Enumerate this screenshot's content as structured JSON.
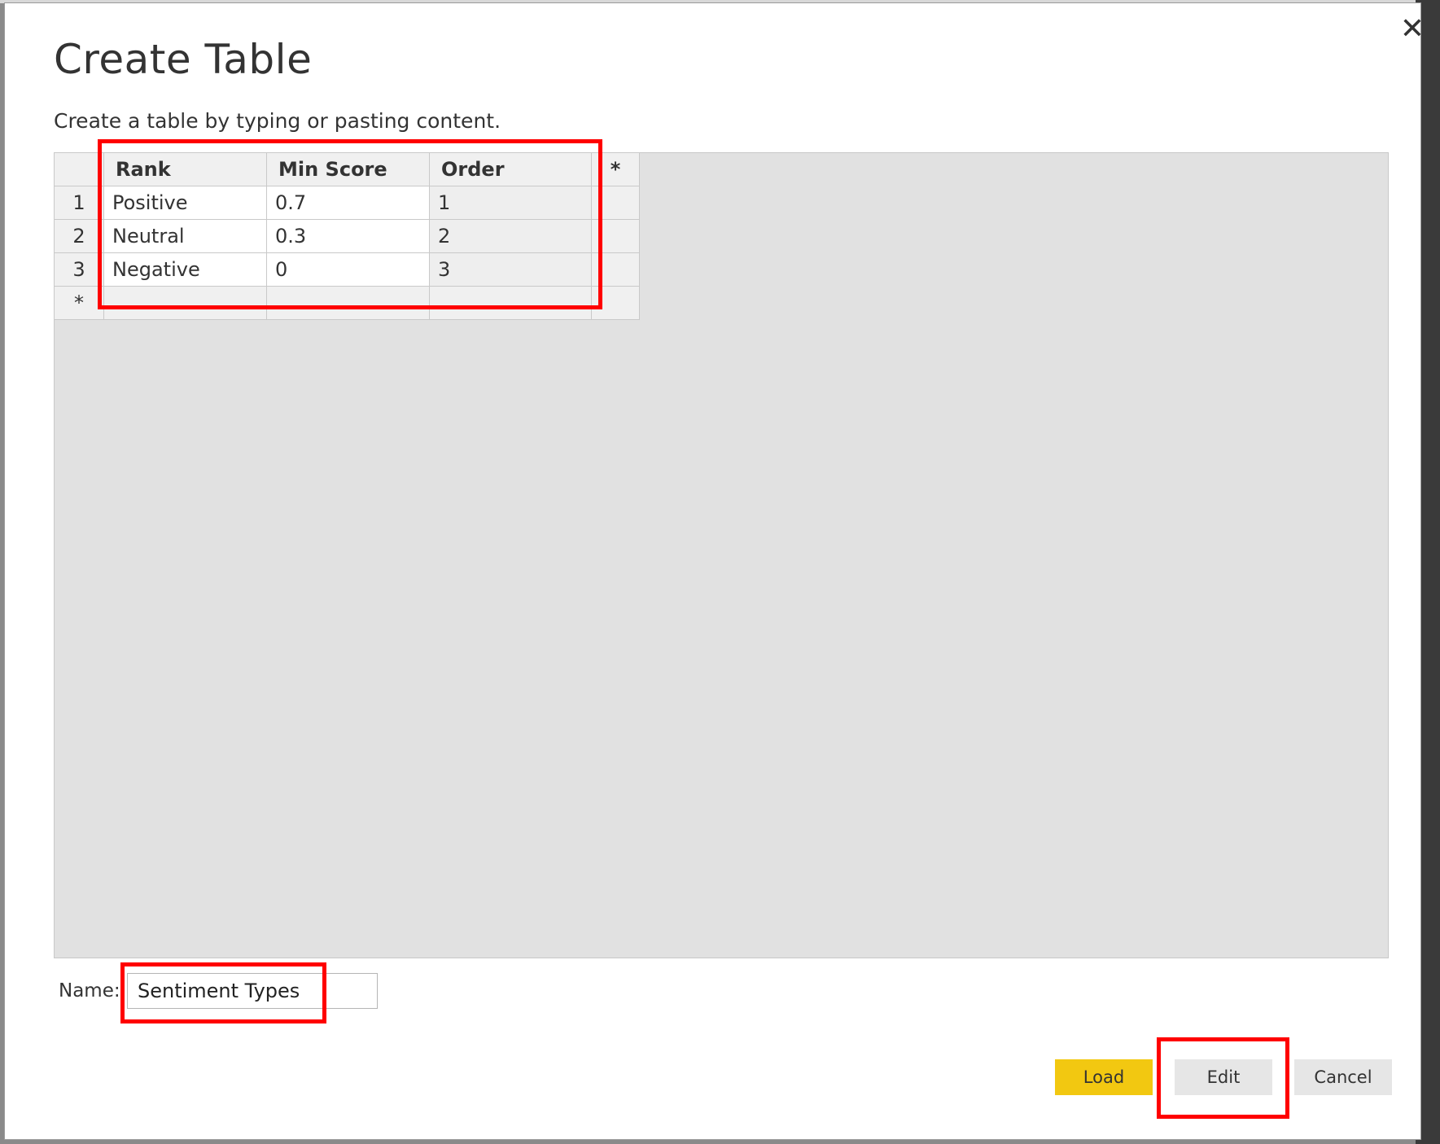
{
  "dialog": {
    "title": "Create Table",
    "subtitle": "Create a table by typing or pasting content.",
    "close_glyph": "✕"
  },
  "table": {
    "headers": [
      "Rank",
      "Min Score",
      "Order"
    ],
    "add_column_glyph": "*",
    "rows": [
      {
        "num": "1",
        "cells": [
          "Positive",
          "0.7",
          "1"
        ]
      },
      {
        "num": "2",
        "cells": [
          "Neutral",
          "0.3",
          "2"
        ]
      },
      {
        "num": "3",
        "cells": [
          "Negative",
          "0",
          "3"
        ]
      }
    ],
    "new_row_glyph": "*"
  },
  "name_field": {
    "label": "Name:",
    "value": "Sentiment Types"
  },
  "buttons": {
    "load": "Load",
    "edit": "Edit",
    "cancel": "Cancel"
  },
  "colors": {
    "accent_load": "#f2c811",
    "highlight": "#ff0000"
  }
}
